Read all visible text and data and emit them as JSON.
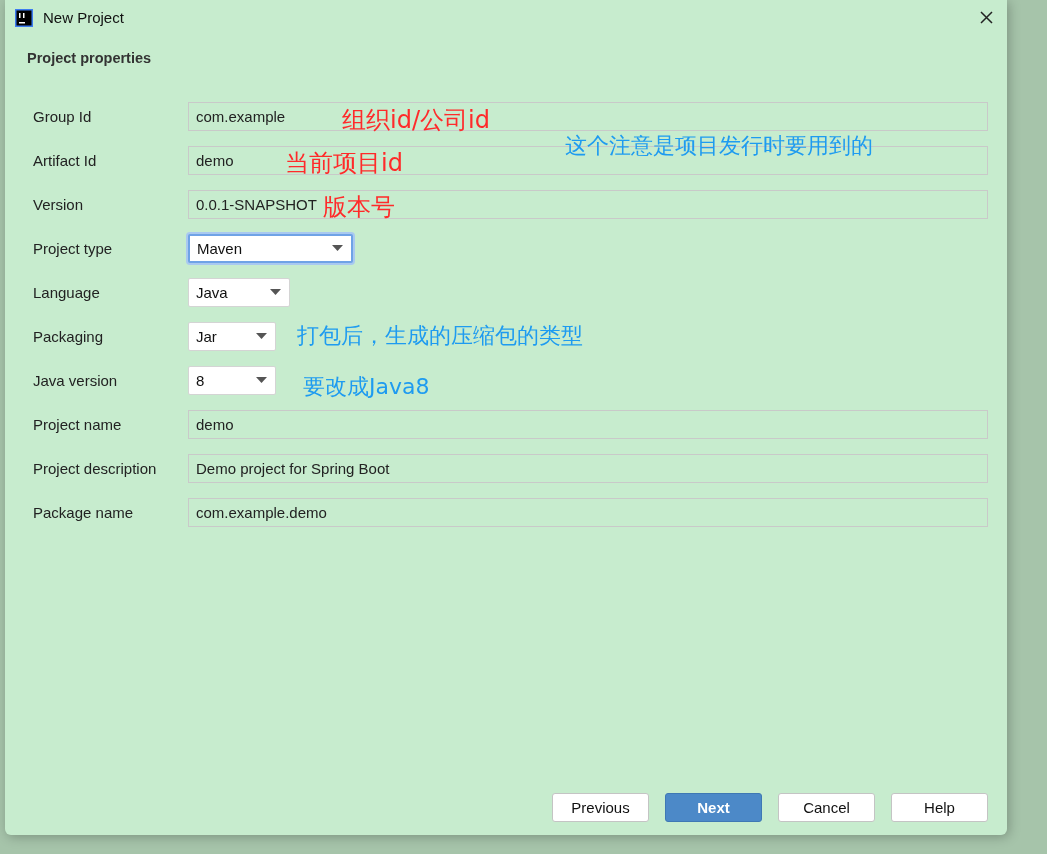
{
  "window": {
    "title": "New Project"
  },
  "section_title": "Project properties",
  "fields": [
    {
      "label": "Group Id",
      "kind": "text",
      "value": "com.example",
      "focused": false
    },
    {
      "label": "Artifact Id",
      "kind": "text",
      "value": "demo",
      "focused": false
    },
    {
      "label": "Version",
      "kind": "text",
      "value": "0.0.1-SNAPSHOT",
      "focused": false
    },
    {
      "label": "Project type",
      "kind": "select",
      "value": "Maven",
      "focused": true
    },
    {
      "label": "Language",
      "kind": "select",
      "value": "Java",
      "focused": false
    },
    {
      "label": "Packaging",
      "kind": "select",
      "value": "Jar",
      "focused": false
    },
    {
      "label": "Java version",
      "kind": "select",
      "value": "8",
      "focused": false
    },
    {
      "label": "Project name",
      "kind": "text",
      "value": "demo",
      "focused": false
    },
    {
      "label": "Project description",
      "kind": "text",
      "value": "Demo project for Spring Boot",
      "focused": false
    },
    {
      "label": "Package name",
      "kind": "text",
      "value": "com.example.demo",
      "focused": false
    }
  ],
  "annotations": [
    {
      "text": "组织id/公司id",
      "color": "#ff2a2a"
    },
    {
      "text": "当前项目id",
      "color": "#ff2a2a"
    },
    {
      "text": "版本号",
      "color": "#ff2a2a"
    },
    {
      "text": "这个注意是项目发行时要用到的",
      "color": "#1e9bf0"
    },
    {
      "text": "打包后，生成的压缩包的类型",
      "color": "#1e9bf0"
    },
    {
      "text": "要改成Java8",
      "color": "#1e9bf0"
    }
  ],
  "buttons": [
    {
      "label": "Previous",
      "kind": "default"
    },
    {
      "label": "Next",
      "kind": "primary"
    },
    {
      "label": "Cancel",
      "kind": "default"
    },
    {
      "label": "Help",
      "kind": "default"
    }
  ]
}
